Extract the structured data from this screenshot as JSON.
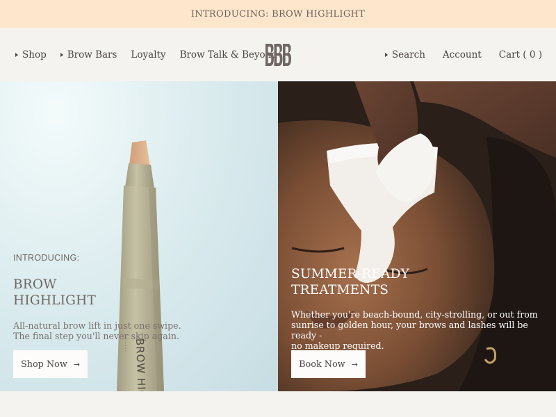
{
  "announcement": {
    "text": "INTRODUCING: BROW HIGHLIGHT"
  },
  "nav": {
    "left": [
      {
        "label": "Shop",
        "has_caret": true
      },
      {
        "label": "Brow Bars",
        "has_caret": true
      },
      {
        "label": "Loyalty",
        "has_caret": false
      },
      {
        "label": "Brow Talk & Beyond",
        "has_caret": false
      }
    ],
    "right": {
      "search": "Search",
      "account": "Account",
      "cart": "Cart ( 0 )"
    }
  },
  "hero": {
    "left": {
      "eyebrow": "INTRODUCING:",
      "title_line1": "BROW",
      "title_line2": "HIGHLIGHT",
      "body_line1": "All-natural brow lift in just one swipe.",
      "body_line2": "The final step you'll never skip again.",
      "cta": "Shop Now",
      "product_text": "BROW HIG"
    },
    "right": {
      "title_line1": "SUMMER-READY",
      "title_line2": "TREATMENTS",
      "body_line1": "Whether you're beach-bound, city-strolling, or out from",
      "body_line2": "sunrise to golden hour, your brows and lashes will be ready -",
      "body_line3": "no makeup required.",
      "cta": "Book Now"
    }
  },
  "colors": {
    "announcement_bg": "#fde6cc",
    "page_bg": "#f5f3f0",
    "text": "#4a4542",
    "button_bg": "#fdfcfa"
  },
  "icons": {
    "arrow": "arrow-right-icon",
    "caret": "caret-right-icon"
  }
}
